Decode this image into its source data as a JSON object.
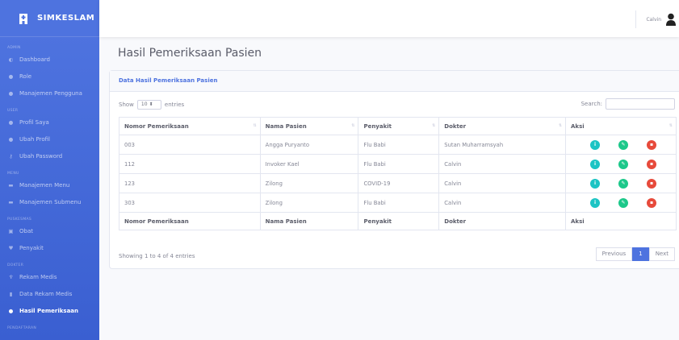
{
  "brand": {
    "name": "SIMKESLAM"
  },
  "sidebar": {
    "sections": [
      {
        "heading": "ADMIN",
        "items": [
          {
            "label": "Dashboard",
            "icon": "dashboard-icon"
          },
          {
            "label": "Role",
            "icon": "user-role-icon"
          },
          {
            "label": "Manajemen Pengguna",
            "icon": "users-icon"
          }
        ]
      },
      {
        "heading": "USER",
        "items": [
          {
            "label": "Profil Saya",
            "icon": "user-icon"
          },
          {
            "label": "Ubah Profil",
            "icon": "user-edit-icon"
          },
          {
            "label": "Ubah Password",
            "icon": "key-icon"
          }
        ]
      },
      {
        "heading": "MENU",
        "items": [
          {
            "label": "Manajemen Menu",
            "icon": "folder-icon"
          },
          {
            "label": "Manajemen Submenu",
            "icon": "folder-open-icon"
          }
        ]
      },
      {
        "heading": "PUSKESMAS",
        "items": [
          {
            "label": "Obat",
            "icon": "pills-icon"
          },
          {
            "label": "Penyakit",
            "icon": "virus-icon"
          }
        ]
      },
      {
        "heading": "DOKTER",
        "items": [
          {
            "label": "Rekam Medis",
            "icon": "stethoscope-icon"
          },
          {
            "label": "Data Rekam Medis",
            "icon": "file-medical-icon"
          },
          {
            "label": "Hasil Pemeriksaan",
            "icon": "user-md-icon",
            "active": true
          }
        ]
      },
      {
        "heading": "PENDAFTARAN",
        "items": []
      }
    ]
  },
  "topbar": {
    "user_name": "Calvin"
  },
  "page": {
    "title": "Hasil Pemeriksaan Pasien"
  },
  "card": {
    "header": "Data Hasil Pemeriksaan Pasien",
    "show_label": "Show",
    "entries_value": "10",
    "entries_label": "entries",
    "search_label": "Search:",
    "search_value": ""
  },
  "table": {
    "columns": [
      "Nomor Pemeriksaan",
      "Nama Pasien",
      "Penyakit",
      "Dokter",
      "Aksi"
    ],
    "rows": [
      [
        "003",
        "Angga Puryanto",
        "Flu Babi",
        "Sutan Muharramsyah"
      ],
      [
        "112",
        "Invoker Kael",
        "Flu Babi",
        "Calvin"
      ],
      [
        "123",
        "Zilong",
        "COVID-19",
        "Calvin"
      ],
      [
        "303",
        "Zilong",
        "Flu Babi",
        "Calvin"
      ]
    ],
    "footer": [
      "Nomor Pemeriksaan",
      "Nama Pasien",
      "Penyakit",
      "Dokter",
      "Aksi"
    ],
    "info": "Showing 1 to 4 of 4 entries"
  },
  "pagination": {
    "previous": "Previous",
    "current": "1",
    "next": "Next"
  },
  "colors": {
    "primary": "#4e73df",
    "info": "#1cc4c4",
    "success": "#1cc88a",
    "danger": "#e74a3b"
  }
}
